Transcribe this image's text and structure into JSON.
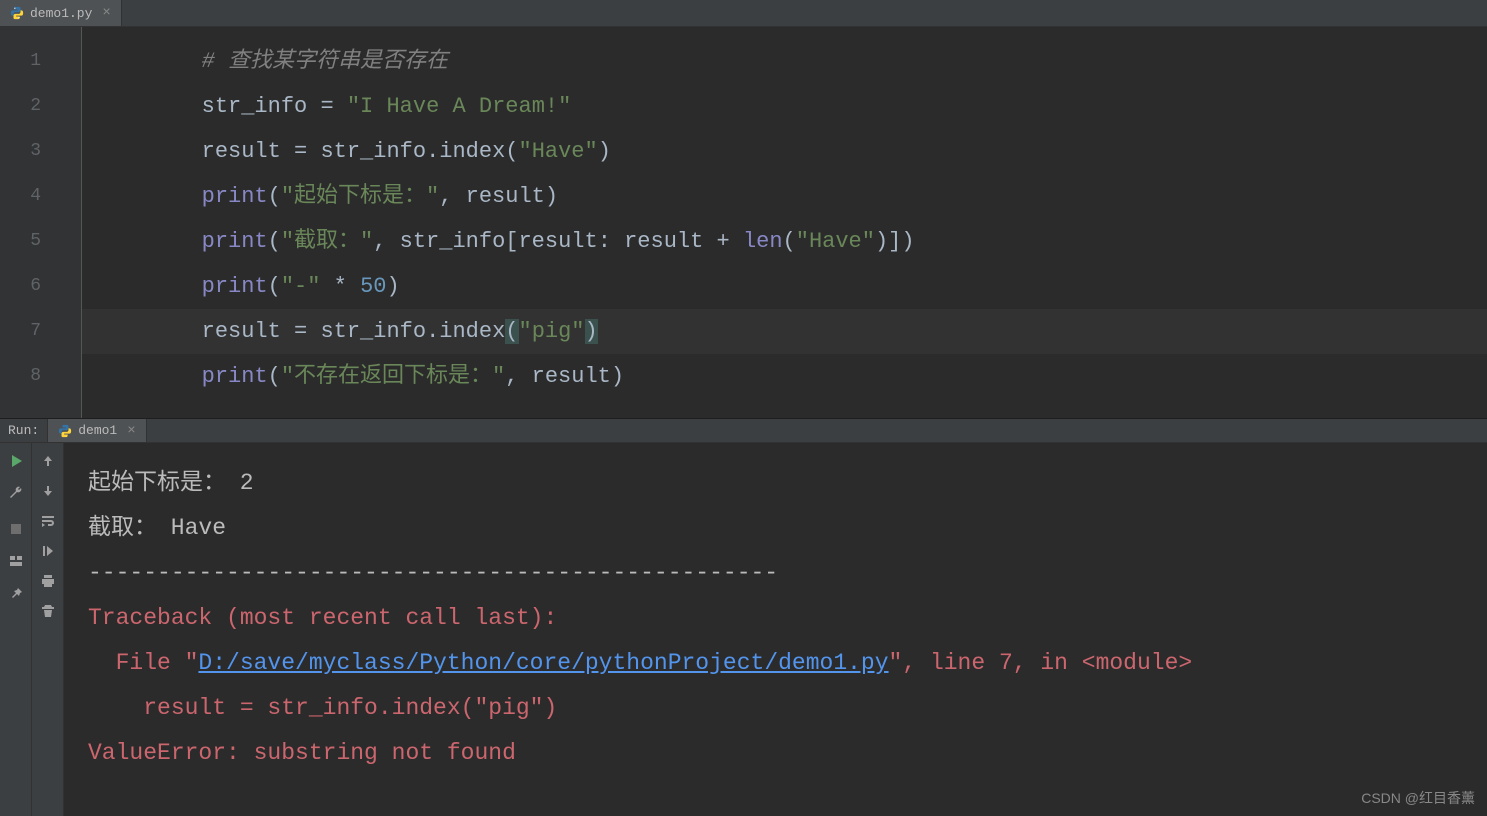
{
  "tab": {
    "filename": "demo1.py"
  },
  "code": {
    "lines": [
      {
        "indent": "        ",
        "segments": [
          {
            "t": "# 查找某字符串是否存在",
            "c": "c-comment"
          }
        ]
      },
      {
        "indent": "        ",
        "segments": [
          {
            "t": "str_info ",
            "c": "c-id"
          },
          {
            "t": "= ",
            "c": "c-op"
          },
          {
            "t": "\"I Have A Dream!\"",
            "c": "c-str"
          }
        ]
      },
      {
        "indent": "        ",
        "segments": [
          {
            "t": "result ",
            "c": "c-id"
          },
          {
            "t": "= ",
            "c": "c-op"
          },
          {
            "t": "str_info.index(",
            "c": "c-id"
          },
          {
            "t": "\"Have\"",
            "c": "c-str"
          },
          {
            "t": ")",
            "c": "c-id"
          }
        ]
      },
      {
        "indent": "        ",
        "segments": [
          {
            "t": "print",
            "c": "c-builtin"
          },
          {
            "t": "(",
            "c": "c-id"
          },
          {
            "t": "\"起始下标是：\"",
            "c": "c-str"
          },
          {
            "t": ", ",
            "c": "c-op"
          },
          {
            "t": "result)",
            "c": "c-id"
          }
        ]
      },
      {
        "indent": "        ",
        "segments": [
          {
            "t": "print",
            "c": "c-builtin"
          },
          {
            "t": "(",
            "c": "c-id"
          },
          {
            "t": "\"截取：\"",
            "c": "c-str"
          },
          {
            "t": ", ",
            "c": "c-op"
          },
          {
            "t": "str_info[result",
            "c": "c-id"
          },
          {
            "t": ": ",
            "c": "c-op"
          },
          {
            "t": "result ",
            "c": "c-id"
          },
          {
            "t": "+ ",
            "c": "c-op"
          },
          {
            "t": "len",
            "c": "c-builtin"
          },
          {
            "t": "(",
            "c": "c-id"
          },
          {
            "t": "\"Have\"",
            "c": "c-str"
          },
          {
            "t": ")])",
            "c": "c-id"
          }
        ]
      },
      {
        "indent": "        ",
        "segments": [
          {
            "t": "print",
            "c": "c-builtin"
          },
          {
            "t": "(",
            "c": "c-id"
          },
          {
            "t": "\"-\"",
            "c": "c-str"
          },
          {
            "t": " * ",
            "c": "c-op"
          },
          {
            "t": "50",
            "c": "c-num"
          },
          {
            "t": ")",
            "c": "c-id"
          }
        ]
      },
      {
        "indent": "        ",
        "current": true,
        "segments": [
          {
            "t": "result ",
            "c": "c-id"
          },
          {
            "t": "= ",
            "c": "c-op"
          },
          {
            "t": "str_info.index",
            "c": "c-id"
          },
          {
            "t": "(",
            "c": "c-id hl-paren"
          },
          {
            "t": "\"pig\"",
            "c": "c-str"
          },
          {
            "t": ")",
            "c": "c-id hl-paren"
          }
        ]
      },
      {
        "indent": "        ",
        "segments": [
          {
            "t": "print",
            "c": "c-builtin"
          },
          {
            "t": "(",
            "c": "c-id"
          },
          {
            "t": "\"不存在返回下标是：\"",
            "c": "c-str"
          },
          {
            "t": ", ",
            "c": "c-op"
          },
          {
            "t": "result)",
            "c": "c-id"
          }
        ]
      }
    ],
    "gutter": [
      "1",
      "2",
      "3",
      "4",
      "5",
      "6",
      "7",
      "8"
    ]
  },
  "run": {
    "label": "Run:",
    "tab_name": "demo1",
    "output": [
      {
        "type": "out",
        "text": "起始下标是： 2"
      },
      {
        "type": "out",
        "text": "截取： Have"
      },
      {
        "type": "out",
        "text": "--------------------------------------------------"
      },
      {
        "type": "err",
        "segments": [
          {
            "t": "Traceback (most recent call last):"
          }
        ]
      },
      {
        "type": "err",
        "segments": [
          {
            "t": "  File \""
          },
          {
            "t": "D:/save/myclass/Python/core/pythonProject/demo1.py",
            "link": true
          },
          {
            "t": "\", line 7, in <module>"
          }
        ]
      },
      {
        "type": "err",
        "segments": [
          {
            "t": "    result = str_info.index(\"pig\")"
          }
        ]
      },
      {
        "type": "err",
        "segments": [
          {
            "t": "ValueError: substring not found"
          }
        ]
      }
    ]
  },
  "watermark": "CSDN @红目香薰"
}
